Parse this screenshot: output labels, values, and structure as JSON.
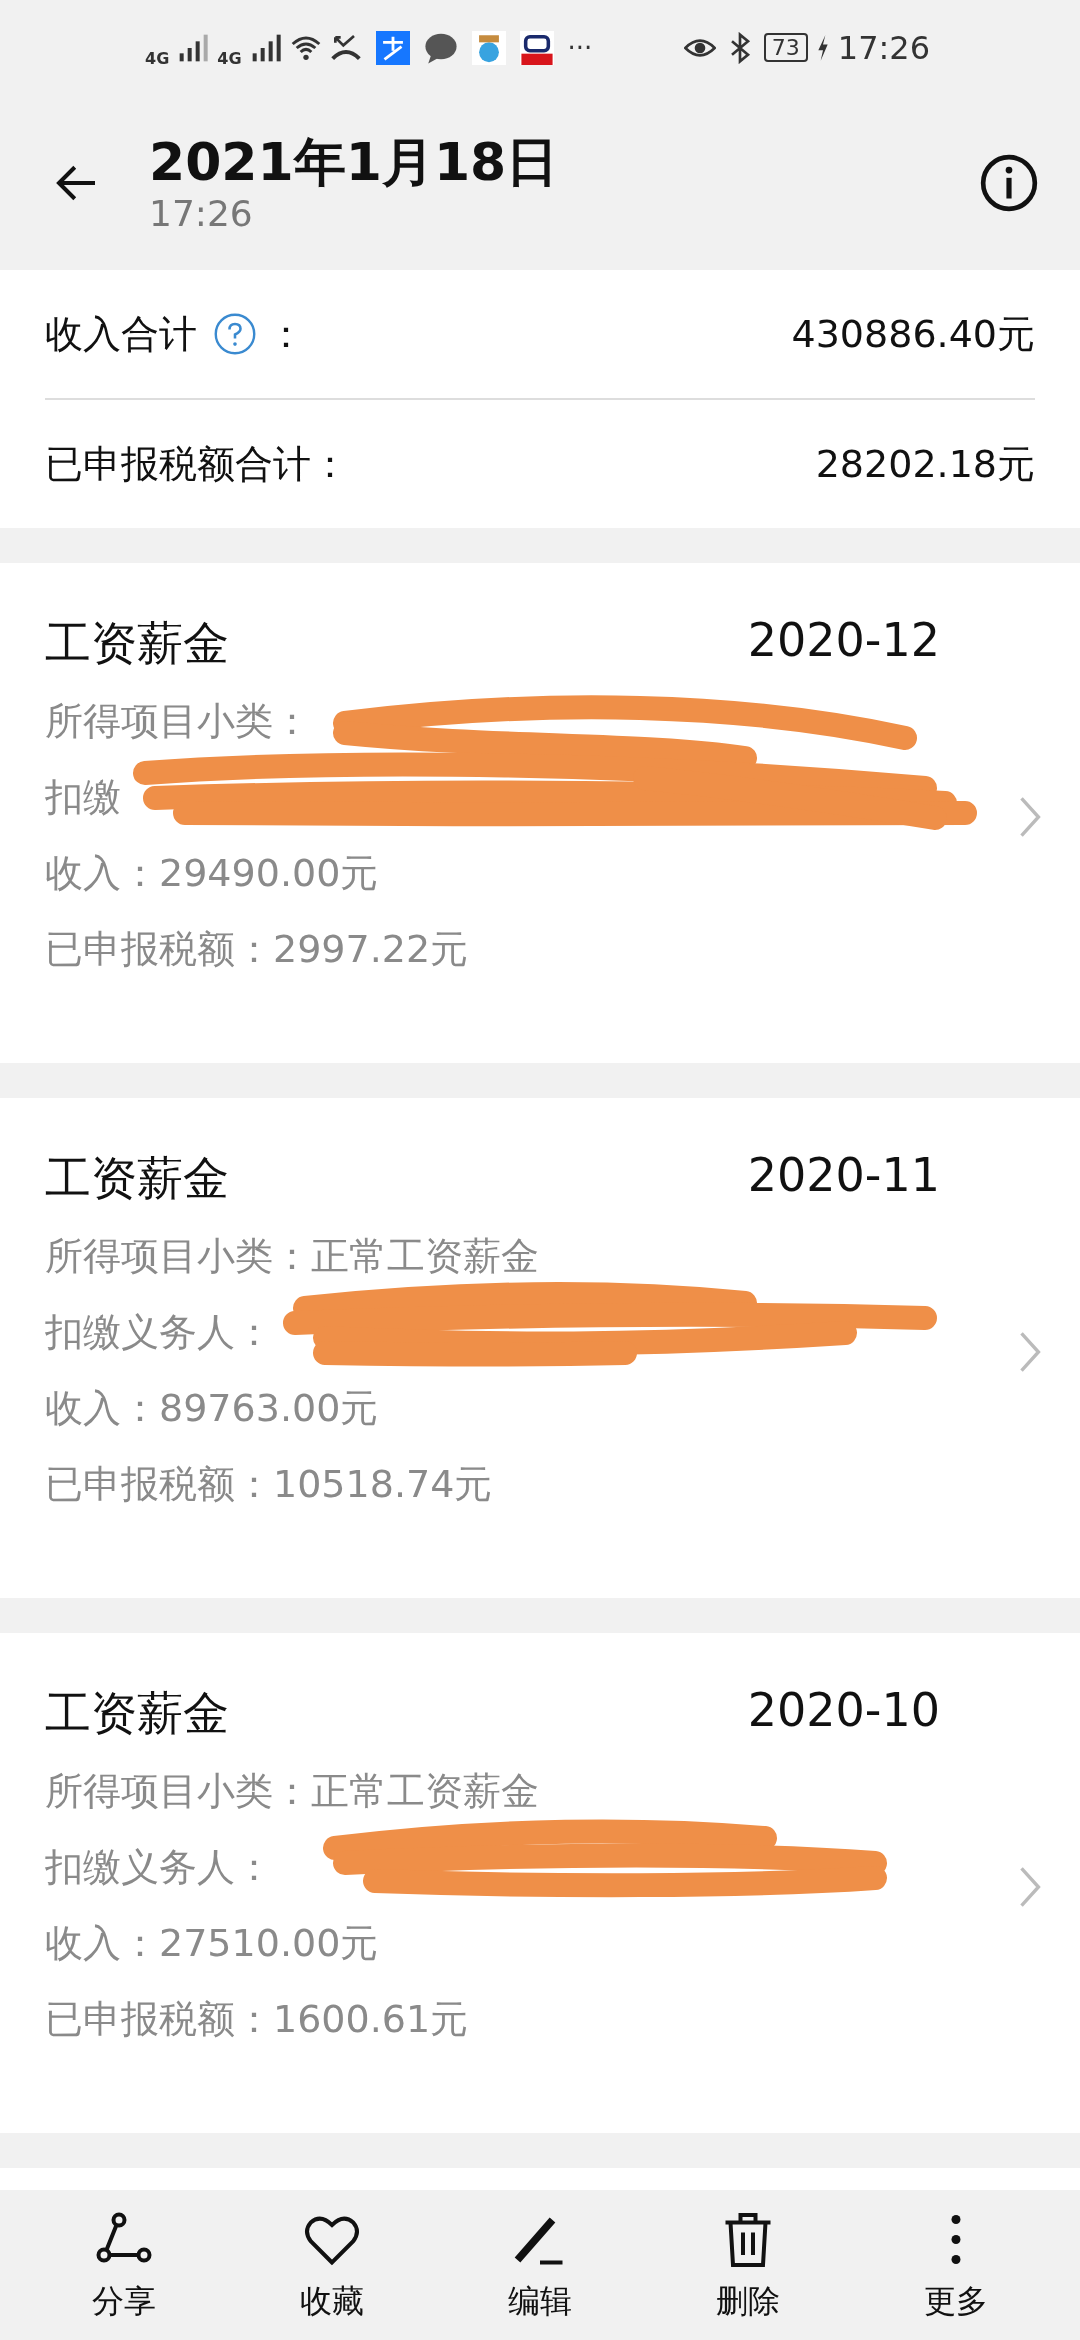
{
  "status_bar": {
    "network_1": "4G",
    "network_2": "4G",
    "more": "···",
    "battery": "73",
    "time": "17:26"
  },
  "header": {
    "title": "2021年1月18日",
    "subtitle": "17:26"
  },
  "summary": [
    {
      "label": "收入合计",
      "help": true,
      "colon": "：",
      "value": "430886.40元"
    },
    {
      "label": "已申报税额合计：",
      "help": false,
      "value": "28202.18元"
    }
  ],
  "records": [
    {
      "title": "工资薪金",
      "period": "2020-12",
      "subcategory_label": "所得项目小类：",
      "withholder_label": "扣缴",
      "income": "收入：29490.00元",
      "tax": "已申报税额：2997.22元"
    },
    {
      "title": "工资薪金",
      "period": "2020-11",
      "subcategory_label": "所得项目小类：",
      "subcategory": "正常工资薪金",
      "withholder_label": "扣缴义务人：",
      "income": "收入：89763.00元",
      "tax": "已申报税额：10518.74元"
    },
    {
      "title": "工资薪金",
      "period": "2020-10",
      "subcategory_label": "所得项目小类：",
      "subcategory": "正常工资薪金",
      "withholder_label": "扣缴义务人：",
      "income": "收入：27510.00元",
      "tax": "已申报税额：1600.61元"
    }
  ],
  "toolbar": [
    {
      "kind": "share",
      "label": "分享"
    },
    {
      "kind": "favorite",
      "label": "收藏"
    },
    {
      "kind": "edit",
      "label": "编辑"
    },
    {
      "kind": "delete",
      "label": "删除"
    },
    {
      "kind": "more",
      "label": "更多"
    }
  ]
}
